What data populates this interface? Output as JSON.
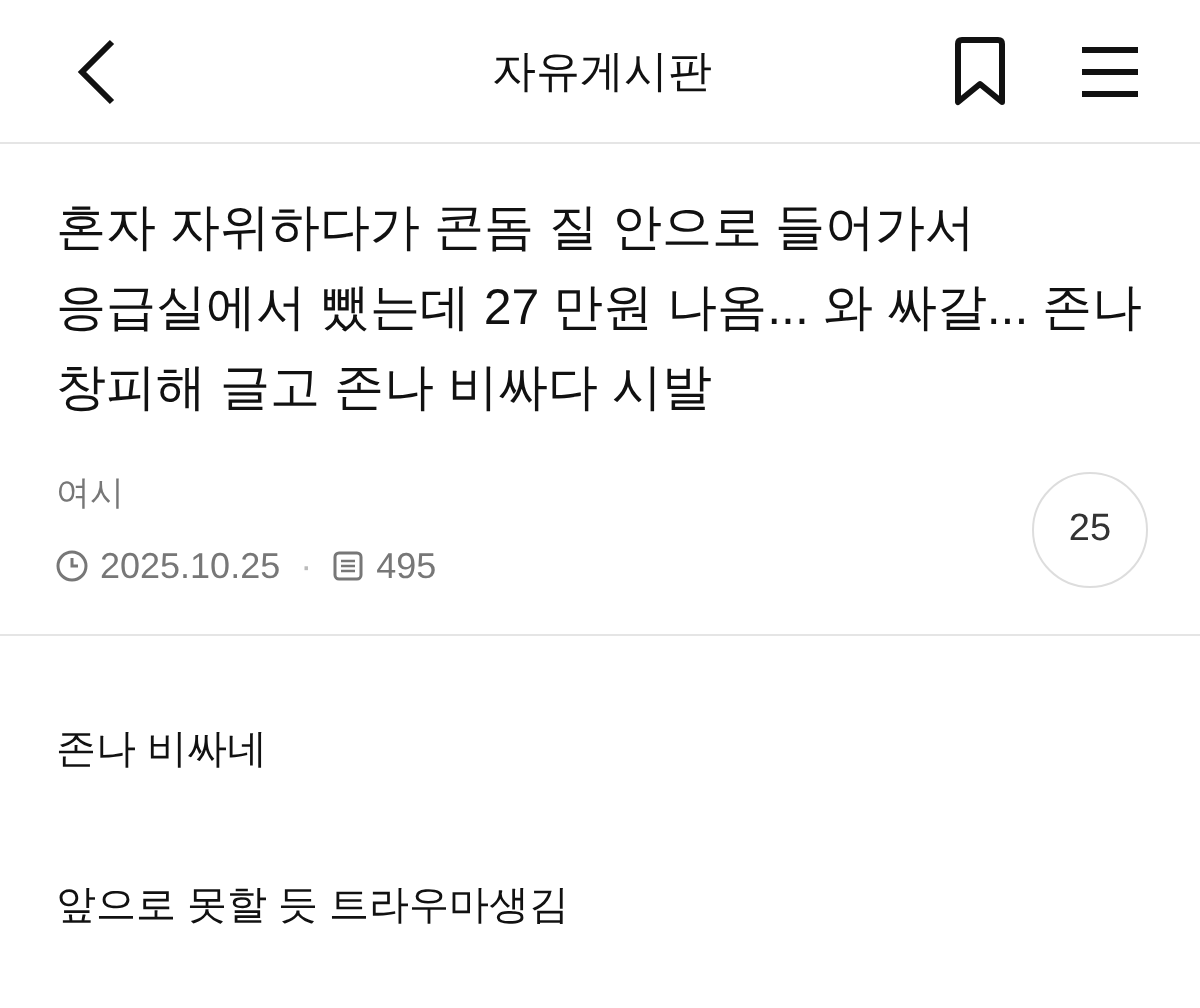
{
  "header": {
    "title": "자유게시판"
  },
  "post": {
    "title": "혼자 자위하다가 콘돔 질 안으로 들어가서 응급실에서 뺐는데 27 만원 나옴... 와 싸갈... 존나 창피해 글고 존나 비싸다 시발",
    "author": "여시",
    "date": "2025.10.25",
    "separator": "·",
    "views": "495",
    "comment_count": "25"
  },
  "comments": [
    {
      "text": "존나 비싸네"
    },
    {
      "text": "앞으로 못할 듯 트라우마생김"
    }
  ]
}
